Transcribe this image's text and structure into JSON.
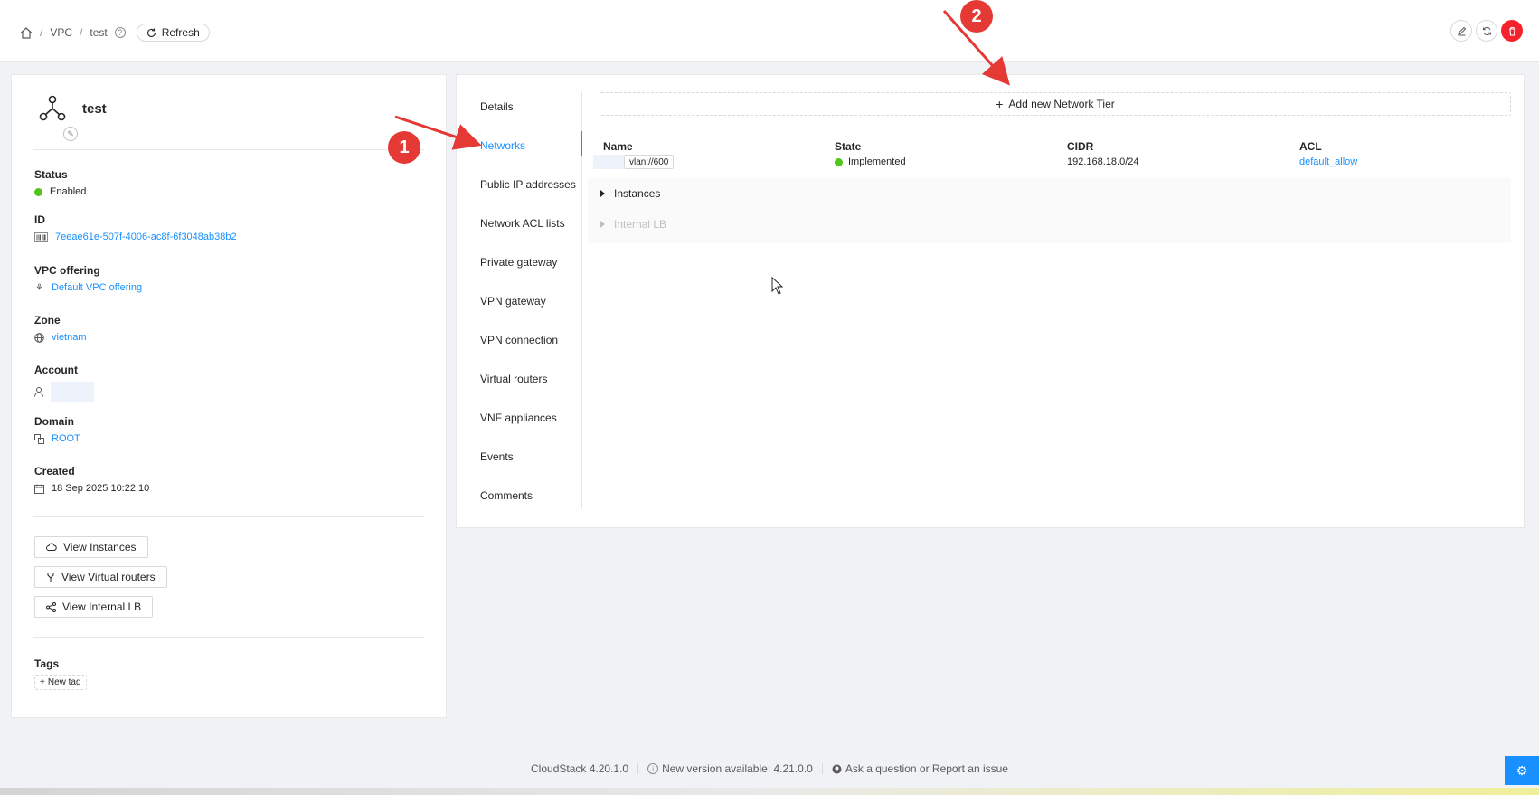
{
  "breadcrumb": {
    "home": "home",
    "vpc": "VPC",
    "current": "test",
    "refresh": "Refresh"
  },
  "top_actions": {
    "edit": "edit",
    "sync": "sync",
    "delete": "delete"
  },
  "resource": {
    "name": "test",
    "status_label": "Status",
    "status_value": "Enabled",
    "id_label": "ID",
    "id_value": "7eeae61e-507f-4006-ac8f-6f3048ab38b2",
    "offering_label": "VPC offering",
    "offering_value": "Default VPC offering",
    "zone_label": "Zone",
    "zone_value": "vietnam",
    "account_label": "Account",
    "domain_label": "Domain",
    "domain_value": "ROOT",
    "created_label": "Created",
    "created_value": "18 Sep 2025 10:22:10",
    "view_instances": "View Instances",
    "view_routers": "View Virtual routers",
    "view_lb": "View Internal LB",
    "tags_label": "Tags",
    "new_tag": "New tag"
  },
  "tabs": [
    "Details",
    "Networks",
    "Public IP addresses",
    "Network ACL lists",
    "Private gateway",
    "VPN gateway",
    "VPN connection",
    "Virtual routers",
    "VNF appliances",
    "Events",
    "Comments"
  ],
  "active_tab": "Networks",
  "networks": {
    "add_button": "Add new Network Tier",
    "headers": {
      "name": "Name",
      "state": "State",
      "cidr": "CIDR",
      "acl": "ACL"
    },
    "row": {
      "vlan": "vlan://600",
      "state": "Implemented",
      "cidr": "192.168.18.0/24",
      "acl": "default_allow"
    },
    "expand_instances": "Instances",
    "expand_lb": "Internal LB"
  },
  "footer": {
    "version": "CloudStack 4.20.1.0",
    "new_version": "New version available: 4.21.0.0",
    "help": "Ask a question or Report an issue"
  },
  "annotations": {
    "one": "1",
    "two": "2"
  },
  "colors": {
    "primary": "#1890ff",
    "success": "#52c41a",
    "danger": "#f5222d",
    "annotation": "#e53935"
  }
}
